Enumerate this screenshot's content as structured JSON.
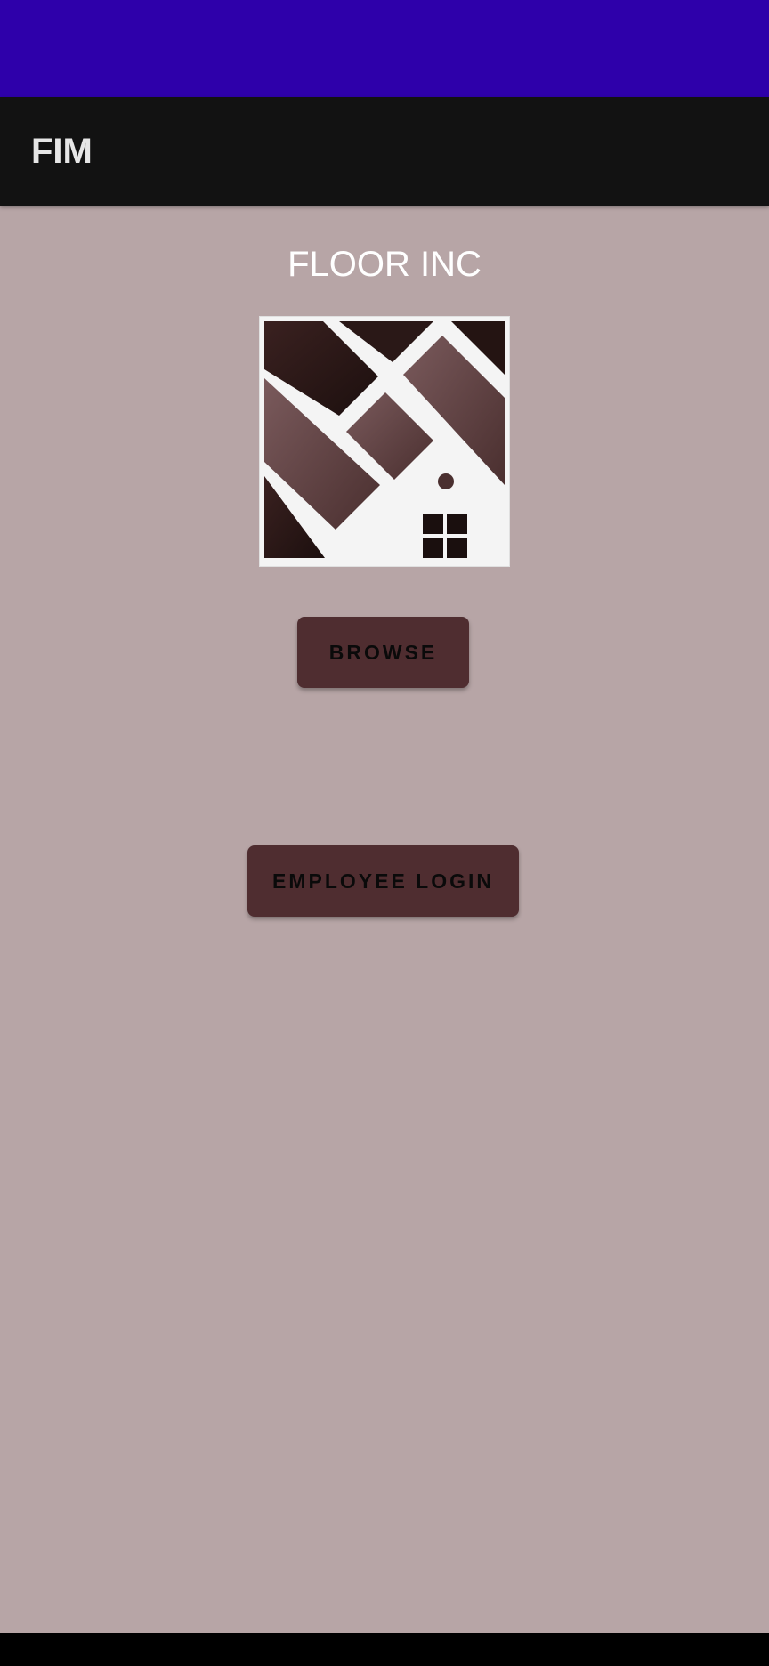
{
  "app_bar": {
    "title": "FIM"
  },
  "main": {
    "company_name": "FLOOR INC",
    "logo_icon": "house-floor-tiles-logo",
    "browse_label": "BROWSE",
    "employee_login_label": "EMPLOYEE LOGIN"
  },
  "colors": {
    "status_bar": "#2e00aa",
    "app_bar": "#121212",
    "background": "#b7a5a6",
    "button": "#4f2d30",
    "button_text": "#0a0a0a",
    "nav_bar": "#000000"
  }
}
